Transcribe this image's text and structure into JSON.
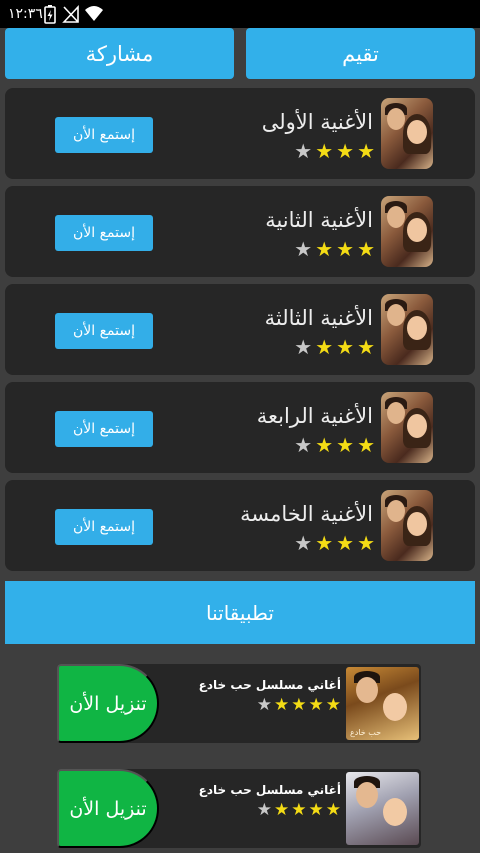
{
  "status_bar": {
    "time": "١٢:٣٦",
    "icons": [
      "battery-charging-icon",
      "no-signal-icon",
      "wifi-icon"
    ]
  },
  "top_buttons": {
    "share_label": "مشاركة",
    "rate_label": "تقيم"
  },
  "songs": [
    {
      "title": "الأغنية الأولى",
      "listen_label": "إستمع الأن",
      "rating": 3,
      "rating_max": 4
    },
    {
      "title": "الأغنية الثانية",
      "listen_label": "إستمع الأن",
      "rating": 3,
      "rating_max": 4
    },
    {
      "title": "الأغنية الثالثة",
      "listen_label": "إستمع الأن",
      "rating": 3,
      "rating_max": 4
    },
    {
      "title": "الأغنية الرابعة",
      "listen_label": "إستمع الأن",
      "rating": 3,
      "rating_max": 4
    },
    {
      "title": "الأغنية الخامسة",
      "listen_label": "إستمع الأن",
      "rating": 3,
      "rating_max": 4
    }
  ],
  "apps_section": {
    "title": "تطبيقاتنا",
    "apps": [
      {
        "title": "أغاني مسلسل حب خادع",
        "download_label": "تنزيل الأن",
        "rating": 4,
        "rating_max": 5,
        "thumb_caption": "حب خادع"
      },
      {
        "title": "أغاني مسلسل حب خادع",
        "download_label": "تنزيل الأن",
        "rating": 4,
        "rating_max": 5,
        "thumb_caption": ""
      }
    ]
  },
  "colors": {
    "accent_blue": "#32b0ea",
    "download_green": "#10b544",
    "star_yellow": "#f4dc15",
    "card_bg": "#262626",
    "page_bg": "#3e3e3e"
  }
}
